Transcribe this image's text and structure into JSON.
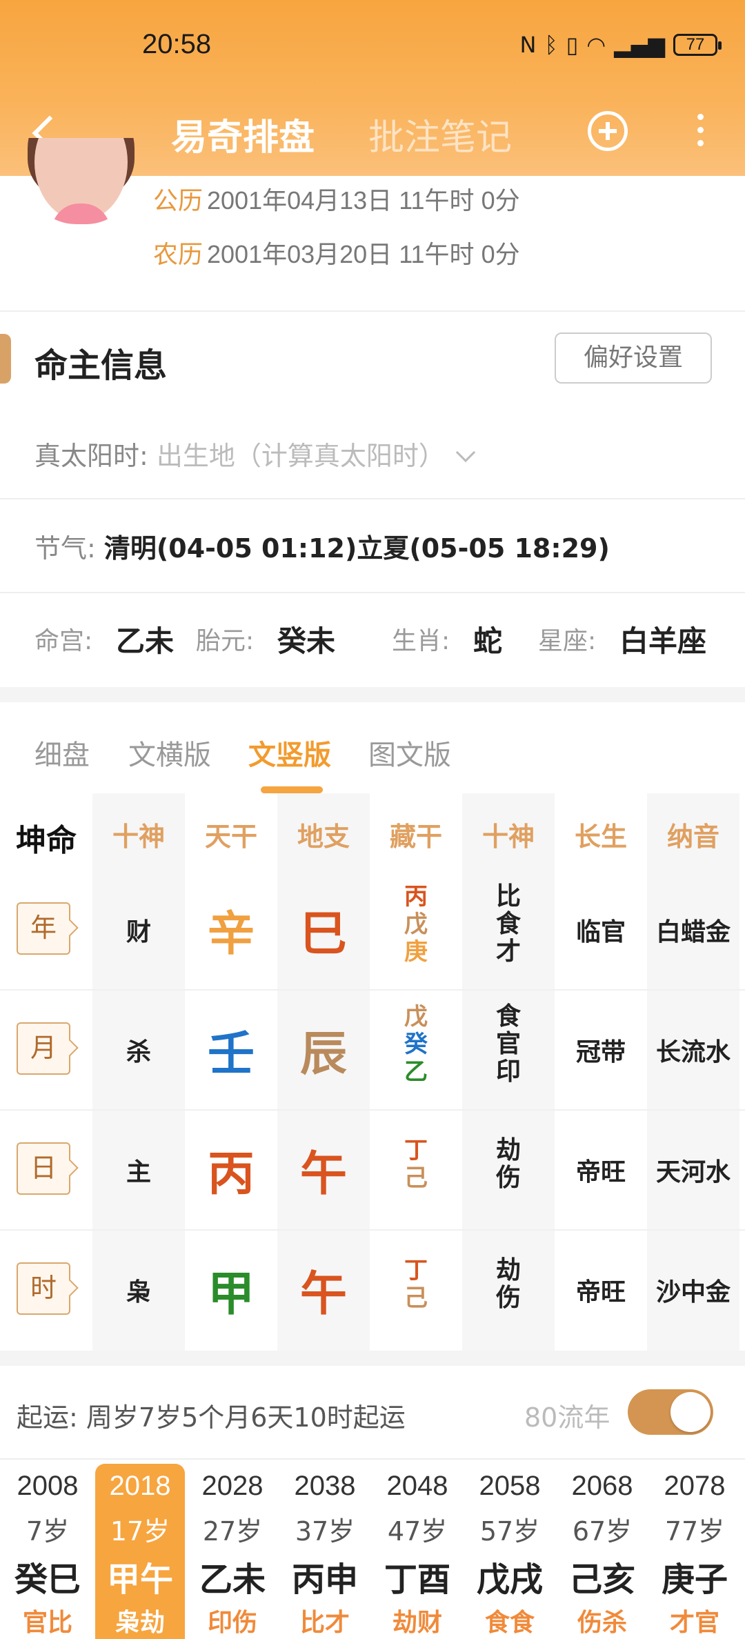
{
  "status_bar": {
    "time": "20:58",
    "battery": "77",
    "icons": [
      "nfc-icon",
      "bluetooth-icon",
      "vibrate-icon",
      "wifi-icon",
      "signal-5g-icon"
    ]
  },
  "nav": {
    "tab_active": "易奇排盘",
    "tab_other": "批注笔记"
  },
  "profile": {
    "solar_label": "公历",
    "solar": "2001年04月13日 11午时 0分",
    "lunar_label": "农历",
    "lunar": "2001年03月20日 11午时 0分"
  },
  "info": {
    "title": "命主信息",
    "pref_button": "偏好设置",
    "true_solar_label": "真太阳时:",
    "true_solar_placeholder": "出生地（计算真太阳时）",
    "jieqi_label": "节气:",
    "jieqi_value": "清明(04-05 01:12)立夏(05-05 18:29)",
    "minggong_label": "命宫:",
    "minggong": "乙未",
    "taiyuan_label": "胎元:",
    "taiyuan": "癸未",
    "shengxiao_label": "生肖:",
    "shengxiao": "蛇",
    "xingzuo_label": "星座:",
    "xingzuo": "白羊座"
  },
  "view_tabs": [
    "细盘",
    "文横版",
    "文竖版",
    "图文版"
  ],
  "active_view_tab": "文竖版",
  "table": {
    "headers": [
      "坤命",
      "十神",
      "天干",
      "地支",
      "藏干",
      "十神",
      "长生",
      "纳音"
    ],
    "rows": [
      {
        "pillar": "年",
        "shishen": "财",
        "gan": "辛",
        "gan_color": "#f0a040",
        "zhi": "巳",
        "zhi_color": "#d9541e",
        "canggan": [
          {
            "t": "丙",
            "c": "#d9541e"
          },
          {
            "t": "戊",
            "c": "#c8905a"
          },
          {
            "t": "庚",
            "c": "#f0a040"
          }
        ],
        "cg_shishen": [
          "比",
          "食",
          "才"
        ],
        "changsheng": "临官",
        "nayin": "白蜡金"
      },
      {
        "pillar": "月",
        "shishen": "杀",
        "gan": "壬",
        "gan_color": "#1f73c8",
        "zhi": "辰",
        "zhi_color": "#b98a5c",
        "canggan": [
          {
            "t": "戊",
            "c": "#c8905a"
          },
          {
            "t": "癸",
            "c": "#1f73c8"
          },
          {
            "t": "乙",
            "c": "#2a8c2a"
          }
        ],
        "cg_shishen": [
          "食",
          "官",
          "印"
        ],
        "changsheng": "冠带",
        "nayin": "长流水"
      },
      {
        "pillar": "日",
        "shishen": "主",
        "gan": "丙",
        "gan_color": "#d9541e",
        "zhi": "午",
        "zhi_color": "#d9541e",
        "canggan": [
          {
            "t": "丁",
            "c": "#d9541e"
          },
          {
            "t": "己",
            "c": "#c8905a"
          }
        ],
        "cg_shishen": [
          "劫",
          "伤"
        ],
        "changsheng": "帝旺",
        "nayin": "天河水"
      },
      {
        "pillar": "时",
        "shishen": "枭",
        "gan": "甲",
        "gan_color": "#2a8c2a",
        "zhi": "午",
        "zhi_color": "#d9541e",
        "canggan": [
          {
            "t": "丁",
            "c": "#d9541e"
          },
          {
            "t": "己",
            "c": "#c8905a"
          }
        ],
        "cg_shishen": [
          "劫",
          "伤"
        ],
        "changsheng": "帝旺",
        "nayin": "沙中金"
      }
    ]
  },
  "luck": {
    "start_label": "起运:",
    "start_text": "周岁7岁5个月6天10时起运",
    "flow_label": "80流年",
    "flow_enabled": true,
    "dayun": [
      {
        "year": "2008",
        "age": "7岁",
        "gz": "癸巳",
        "sub": "官比"
      },
      {
        "year": "2018",
        "age": "17岁",
        "gz": "甲午",
        "sub": "枭劫"
      },
      {
        "year": "2028",
        "age": "27岁",
        "gz": "乙未",
        "sub": "印伤"
      },
      {
        "year": "2038",
        "age": "37岁",
        "gz": "丙申",
        "sub": "比才"
      },
      {
        "year": "2048",
        "age": "47岁",
        "gz": "丁酉",
        "sub": "劫财"
      },
      {
        "year": "2058",
        "age": "57岁",
        "gz": "戊戌",
        "sub": "食食"
      },
      {
        "year": "2068",
        "age": "67岁",
        "gz": "己亥",
        "sub": "伤杀"
      },
      {
        "year": "2078",
        "age": "77岁",
        "gz": "庚子",
        "sub": "才官"
      }
    ],
    "active_index": 1
  }
}
